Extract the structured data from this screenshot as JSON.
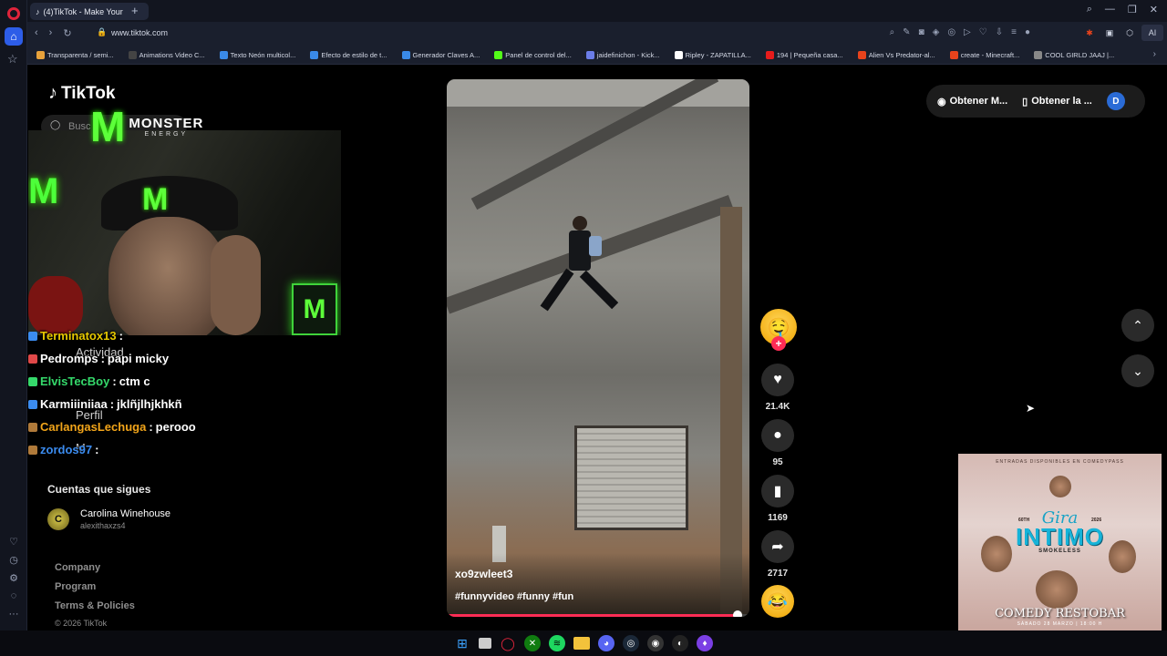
{
  "browser": {
    "tab_title": "(4)TikTok - Make Your",
    "url": "www.tiktok.com",
    "ai_label": "AI",
    "bookmarks": [
      {
        "label": "Transparenta / semi...",
        "color": "#e8a23b"
      },
      {
        "label": "Animations Video C...",
        "color": "#444"
      },
      {
        "label": "Texto Neón multicol...",
        "color": "#3a8ae8"
      },
      {
        "label": "Efecto de estilo de t...",
        "color": "#3a8ae8"
      },
      {
        "label": "Generador Claves A...",
        "color": "#3a8ae8"
      },
      {
        "label": "Panel de control del...",
        "color": "#53fc18"
      },
      {
        "label": "jaidefinichon - Kick...",
        "color": "#6b7de8"
      },
      {
        "label": "Ripley - ZAPATILLA...",
        "color": "#fff"
      },
      {
        "label": "194 | Pequeña casa...",
        "color": "#e81c1c"
      },
      {
        "label": "Alien Vs Predator-al...",
        "color": "#e8431c"
      },
      {
        "label": "create - Minecraft...",
        "color": "#e8431c"
      },
      {
        "label": "COOL GIRLD JAAJ |...",
        "color": "#888"
      }
    ]
  },
  "tiktok": {
    "logo": "TikTok",
    "search_placeholder": "Busc",
    "nav_activity": "Actividad",
    "nav_profile": "Perfil",
    "nav_more": "M",
    "follows_title": "Cuentas que sigues",
    "follow": {
      "name": "Carolina Winehouse",
      "user": "alexithaxzs4",
      "avatar_initial": "C"
    },
    "footer": [
      "Company",
      "Program",
      "Terms & Policies"
    ],
    "copyright": "© 2026 TikTok",
    "top_right": {
      "get_m": "Obtener M...",
      "get_app": "Obtener la ...",
      "avatar": "D"
    }
  },
  "stream": {
    "monster_word": "MONSTER",
    "monster_sub": "ENERGY",
    "chat": [
      {
        "user": "Terminatox13",
        "color": "#e6c800",
        "msg": ""
      },
      {
        "user": "Pedromps",
        "color": "#ffffff",
        "msg": "papi micky"
      },
      {
        "user": "ElvisTecBoy",
        "color": "#35d96b",
        "msg": "ctm c"
      },
      {
        "user": "Karmiiiniiaa",
        "color": "#ffffff",
        "msg": "jklñjlhjkhkñ"
      },
      {
        "user": "CarlangasLechuga",
        "color": "#f2a51a",
        "msg": "perooo"
      },
      {
        "user": "zordos97",
        "color": "#3b8cf0",
        "msg": ""
      }
    ]
  },
  "video": {
    "username": "xo9zwleet3",
    "hashtags": "#funnyvideo #funny #fun",
    "likes": "21.4K",
    "comments": "95",
    "saves": "1169",
    "shares": "2717",
    "progress": 0.96
  },
  "poster": {
    "top_text": "ENTRADAS DISPONIBLES EN COMEDYPASS",
    "gira": "Gira",
    "intimo": "INTIMO",
    "show": "SMOKELESS",
    "year_left": "60TH",
    "year_right": "2026",
    "venue": "COMEDY RESTOBAR",
    "date": "SÁBADO 28 MARZO | 18:00 H"
  }
}
